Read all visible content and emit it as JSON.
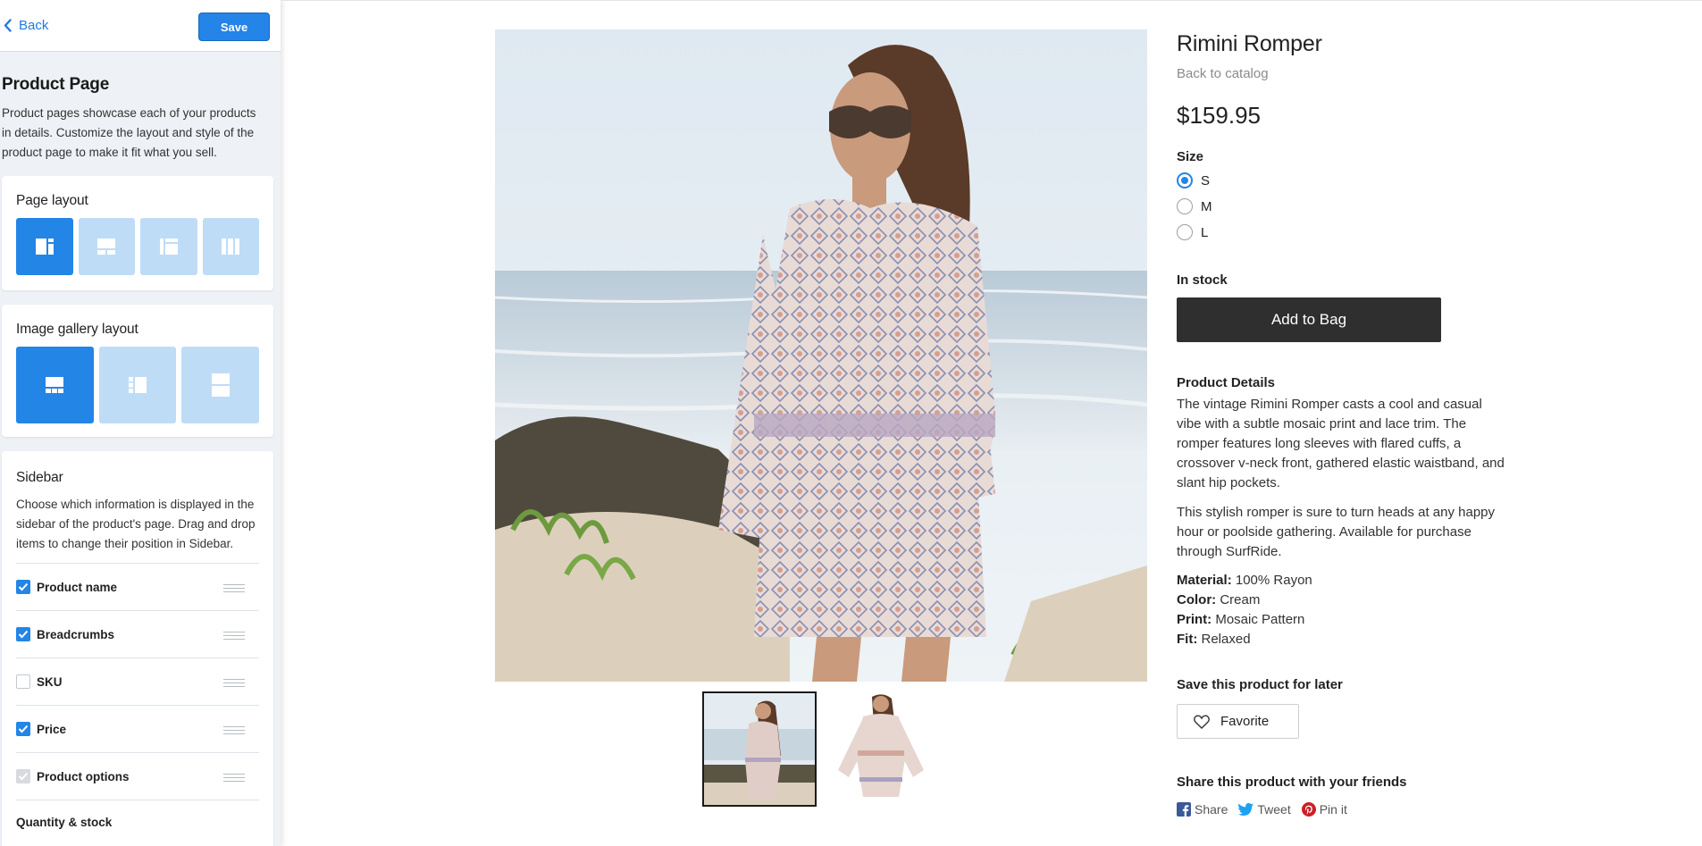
{
  "editor": {
    "back_label": "Back",
    "save_label": "Save",
    "title": "Product Page",
    "description": "Product pages showcase each of your products in details. Customize the layout and style of the product page to make it fit what you sell.",
    "page_layout": {
      "title": "Page layout",
      "options": [
        "layout-image-left",
        "layout-image-top",
        "layout-image-center",
        "layout-columns"
      ],
      "selected_index": 0
    },
    "gallery_layout": {
      "title": "Image gallery layout",
      "options": [
        "gallery-thumbs-below",
        "gallery-thumbs-left",
        "gallery-stacked"
      ],
      "selected_index": 0
    },
    "sidebar": {
      "title": "Sidebar",
      "description": "Choose which information is displayed in the sidebar of the product's page. Drag and drop items to change their position in Sidebar.",
      "items": [
        {
          "label": "Product name",
          "checked": true
        },
        {
          "label": "Breadcrumbs",
          "checked": true
        },
        {
          "label": "SKU",
          "checked": false
        },
        {
          "label": "Price",
          "checked": true
        },
        {
          "label": "Product options",
          "checked": true,
          "disabled": true
        }
      ],
      "last_item_label": "Quantity & stock"
    },
    "accent_color": "#2385e6"
  },
  "product": {
    "name": "Rimini Romper",
    "breadcrumb": "Back to catalog",
    "price": "$159.95",
    "size_label": "Size",
    "sizes": [
      "S",
      "M",
      "L"
    ],
    "selected_size": "S",
    "stock": "In stock",
    "add_to_bag": "Add to Bag",
    "details_heading": "Product Details",
    "description_1": "The vintage Rimini Romper casts a cool and casual vibe with a subtle mosaic print and lace trim. The romper features long sleeves with flared cuffs, a crossover v-neck front, gathered elastic waistband, and slant hip pockets.",
    "description_2": "This stylish romper is sure to turn heads at any happy hour or poolside gathering. Available for purchase through SurfRide.",
    "attributes": [
      {
        "key": "Material:",
        "value": "100% Rayon"
      },
      {
        "key": "Color:",
        "value": "Cream"
      },
      {
        "key": "Print:",
        "value": "Mosaic Pattern"
      },
      {
        "key": "Fit:",
        "value": "Relaxed"
      }
    ],
    "save_heading": "Save this product for later",
    "favorite_label": "Favorite",
    "share_heading": "Share this product with your friends",
    "share": {
      "facebook": "Share",
      "twitter": "Tweet",
      "pinterest": "Pin it"
    },
    "thumbnails_count": 2,
    "selected_thumbnail": 0
  }
}
